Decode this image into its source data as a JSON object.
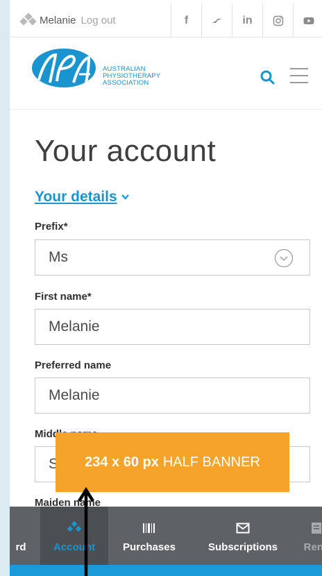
{
  "topbar": {
    "user_name": "Melanie",
    "logout": "Log out",
    "social": [
      "f",
      "in"
    ]
  },
  "header": {
    "org_line1": "AUSTRALIAN",
    "org_line2": "PHYSIOTHERAPY",
    "org_line3": "ASSOCIATION",
    "logo_icon": "apa-logo-icon"
  },
  "main": {
    "title": "Your account",
    "section_link": "Your details",
    "fields": [
      {
        "label": "Prefix*",
        "value": "Ms"
      },
      {
        "label": "First name*",
        "value": "Melanie"
      },
      {
        "label": "Preferred name",
        "value": "Melanie"
      },
      {
        "label": "Middle name",
        "value": "S"
      },
      {
        "label": "Maiden name",
        "value": ""
      }
    ]
  },
  "banner": {
    "size": "234 x 60 px",
    "type": "HALF BANNER"
  },
  "bottom_nav": {
    "items": [
      {
        "label": "rd"
      },
      {
        "label": "Account"
      },
      {
        "label": "Purchases"
      },
      {
        "label": "Subscriptions"
      },
      {
        "label": "Rene"
      }
    ]
  },
  "colors": {
    "brand_blue": "#1994cf",
    "banner_orange": "#f5a32a",
    "nav_bg": "#5e6266"
  }
}
